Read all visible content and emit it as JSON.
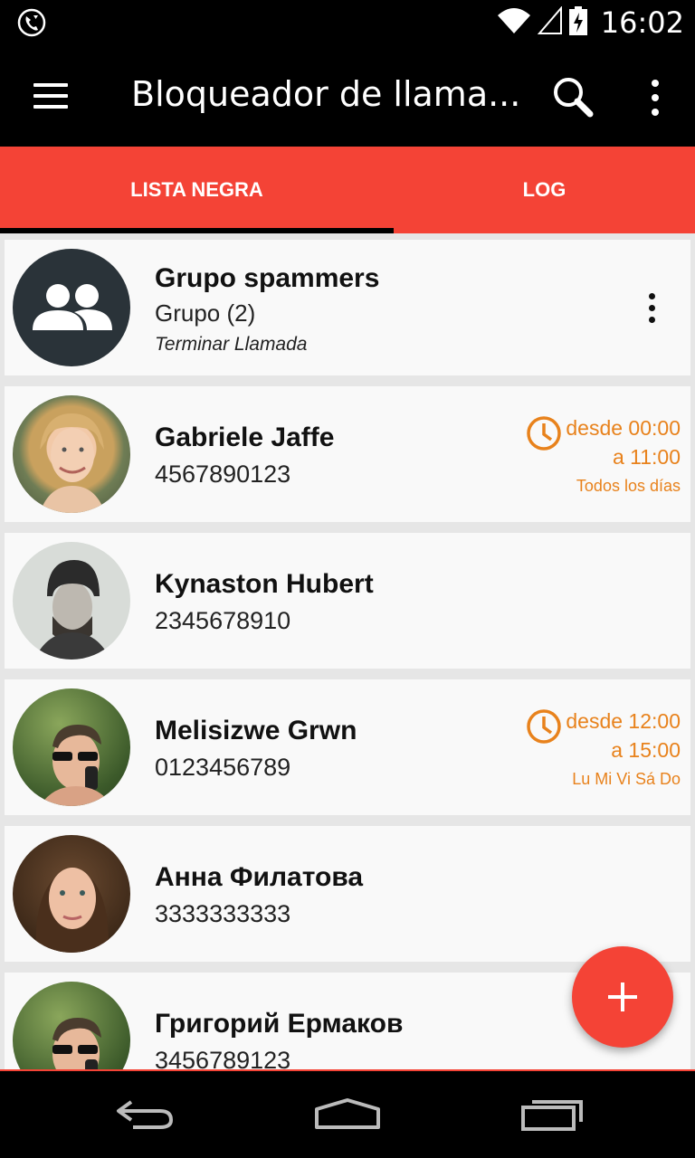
{
  "status_bar": {
    "time": "16:02",
    "left_icon": "call-blocker-notification-icon",
    "icons": [
      "wifi-icon",
      "signal-icon",
      "battery-charging-icon"
    ]
  },
  "app_bar": {
    "title": "Bloqueador de llama...",
    "menu_icon": "hamburger-menu-icon",
    "search_icon": "search-icon",
    "overflow_icon": "more-vert-icon"
  },
  "tabs": [
    {
      "label": "LISTA NEGRA",
      "selected": true
    },
    {
      "label": "LOG",
      "selected": false
    }
  ],
  "group": {
    "name": "Grupo spammers",
    "subtitle": "Grupo (2)",
    "action": "Terminar Llamada",
    "icon": "group-icon"
  },
  "contacts": [
    {
      "name": "Gabriele Jaffe",
      "number": "4567890123",
      "schedule": {
        "from": "desde 00:00",
        "to": "a 11:00",
        "days": "Todos los días"
      }
    },
    {
      "name": "Kynaston Hubert",
      "number": "2345678910"
    },
    {
      "name": "Melisizwe Grwn",
      "number": "0123456789",
      "schedule": {
        "from": "desde 12:00",
        "to": "a 15:00",
        "days": "Lu Mi Vi Sá Do"
      }
    },
    {
      "name": "Анна Филатова",
      "number": "3333333333"
    },
    {
      "name": "Григорий Ермаков",
      "number": "3456789123"
    }
  ],
  "fab": {
    "icon": "add-icon"
  },
  "nav_bar": {
    "icons": [
      "back-icon",
      "home-icon",
      "recents-icon"
    ]
  },
  "colors": {
    "accent": "#f44336",
    "schedule": "#e8821c",
    "group_avatar": "#2a3339",
    "bar_background": "#000000"
  }
}
